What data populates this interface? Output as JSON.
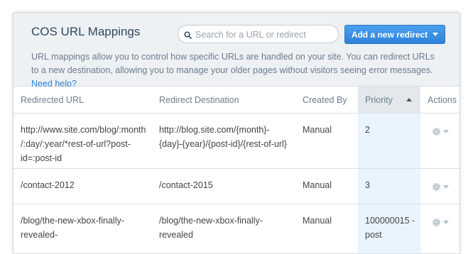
{
  "header": {
    "title": "COS URL Mappings",
    "search_placeholder": "Search for a URL or redirect",
    "add_button_label": "Add a new redirect",
    "description": "URL mappings allow you to control how specific URLs are handled on your site. You can redirect URLs to a new destination, allowing you to manage your older pages without visitors seeing error messages.",
    "help_link": "Need help?"
  },
  "table": {
    "columns": [
      "Redirected URL",
      "Redirect Destination",
      "Created By",
      "Priority",
      "Actions"
    ],
    "sorted_column": "Priority",
    "rows": [
      {
        "redirected_url": "http://www.site.com/blog/:month/:day/:year/*rest-of-url?post-id=:post-id",
        "destination": "http://blog.site.com/{month}-{day}-{year}/{post-id}/{rest-of-url}",
        "created_by": "Manual",
        "priority": "2",
        "actions_icon": "gear-icon"
      },
      {
        "redirected_url": "/contact-2012",
        "destination": "/contact-2015",
        "created_by": "Manual",
        "priority": "3",
        "actions_icon": "gear-icon"
      },
      {
        "redirected_url": "/blog/the-new-xbox-finally-revealed-",
        "destination": "/blog/the-new-xbox-finally-revealed",
        "created_by": "Manual",
        "priority": "100000015 - post",
        "actions_icon": "gear-icon"
      }
    ]
  },
  "colors": {
    "accent": "#2f82d8",
    "header_bg": "#eef1f4",
    "priority_highlight": "#eaf4fe"
  }
}
